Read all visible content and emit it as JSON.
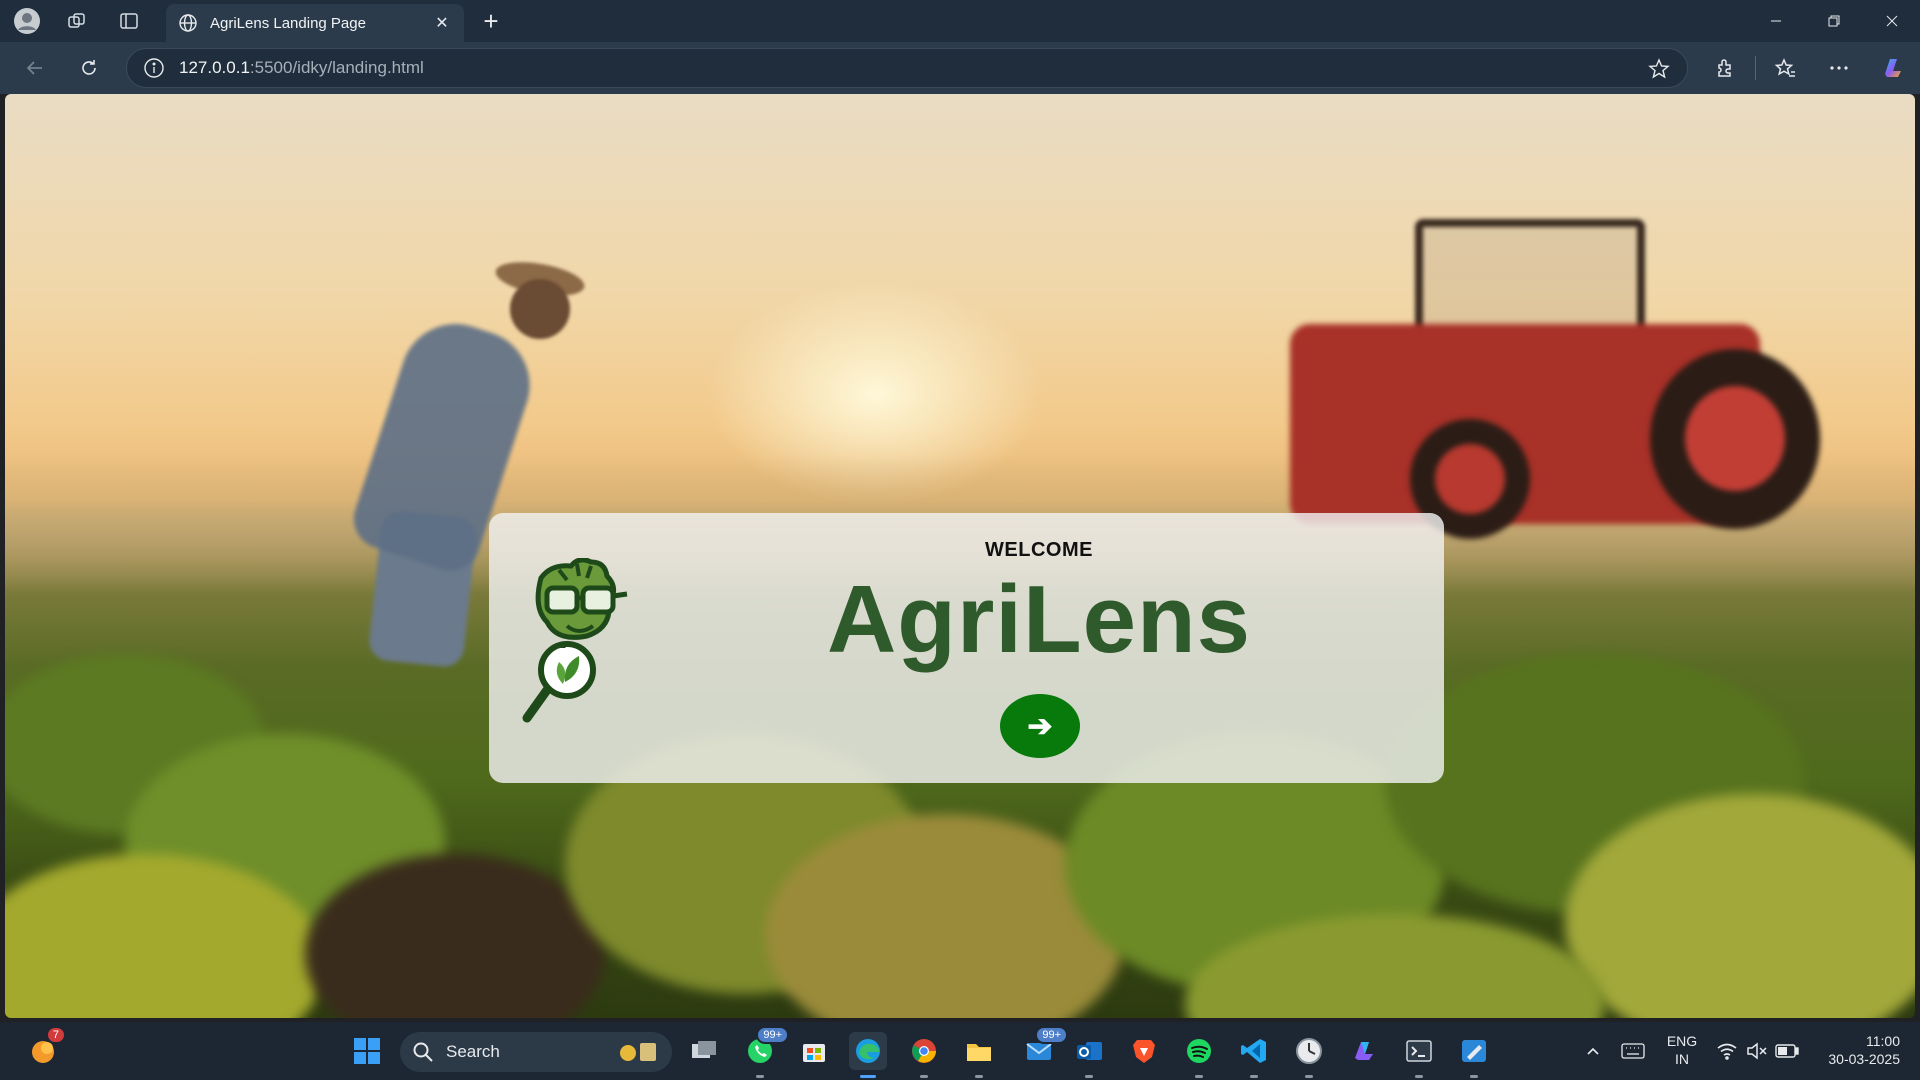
{
  "browser": {
    "tab_title": "AgriLens Landing Page",
    "url_host": "127.0.0.1",
    "url_path": ":5500/idky/landing.html"
  },
  "page": {
    "welcome": "WELCOME",
    "brand": "AgriLens",
    "go_button_label": "➔"
  },
  "taskbar": {
    "search_placeholder": "Search",
    "notification_count": "7",
    "whatsapp_badge": "99+",
    "mail_badge": "99+",
    "language_top": "ENG",
    "language_bottom": "IN",
    "time": "11:00",
    "date": "30-03-2025"
  },
  "icons": [
    "profile-icon",
    "workspaces-icon",
    "tab-actions-icon",
    "globe-icon",
    "close-icon",
    "new-tab-icon",
    "minimize-icon",
    "restore-icon",
    "window-close-icon",
    "back-icon",
    "refresh-icon",
    "info-icon",
    "favorite-star-icon",
    "extensions-icon",
    "favorites-icon",
    "more-icon",
    "copilot-icon"
  ],
  "colors": {
    "brand_green": "#2f5a2b",
    "button_green": "#077a0b",
    "chrome_dark": "#1f2d3c",
    "chrome_mid": "#2b3b4c"
  }
}
